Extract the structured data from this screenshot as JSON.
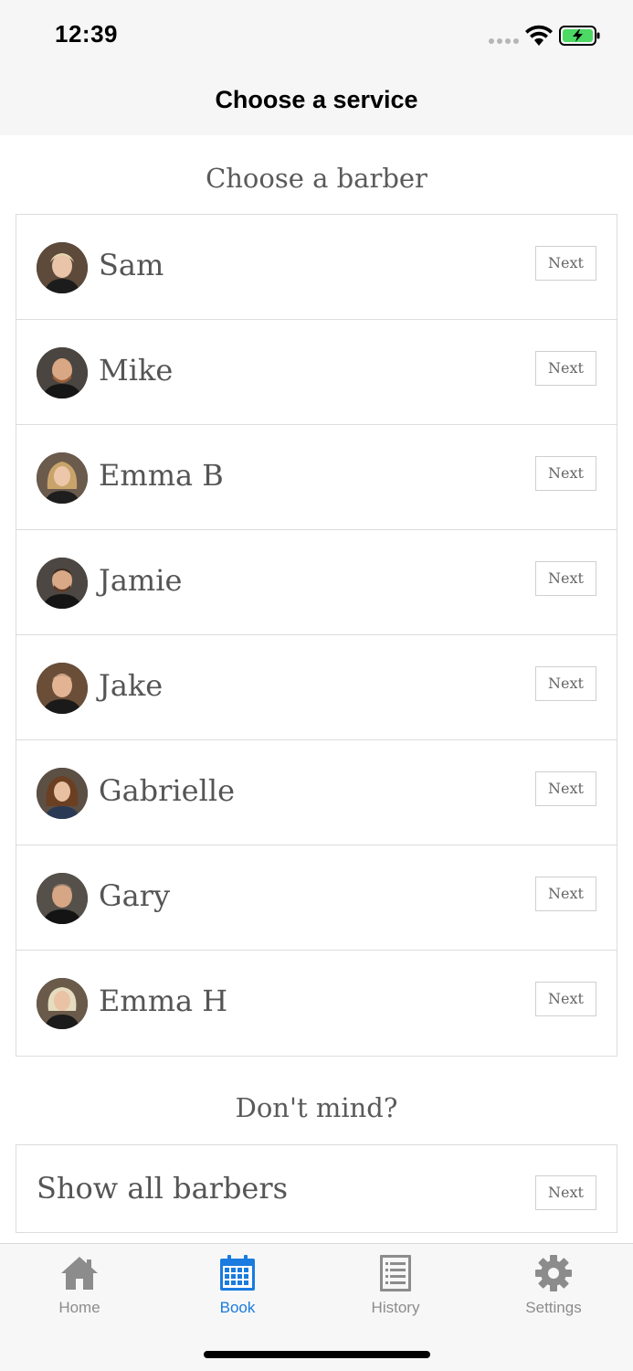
{
  "status_bar": {
    "time": "12:39"
  },
  "nav": {
    "title": "Choose a service"
  },
  "barber_section": {
    "heading": "Choose a barber",
    "barbers": [
      {
        "name": "Sam",
        "next_label": "Next"
      },
      {
        "name": "Mike",
        "next_label": "Next"
      },
      {
        "name": "Emma B",
        "next_label": "Next"
      },
      {
        "name": "Jamie",
        "next_label": "Next"
      },
      {
        "name": "Jake",
        "next_label": "Next"
      },
      {
        "name": "Gabrielle",
        "next_label": "Next"
      },
      {
        "name": "Gary",
        "next_label": "Next"
      },
      {
        "name": "Emma H",
        "next_label": "Next"
      }
    ]
  },
  "any_section": {
    "heading": "Don't mind?",
    "label": "Show all barbers",
    "next_label": "Next"
  },
  "tab_bar": {
    "tabs": [
      {
        "label": "Home",
        "icon": "home-icon",
        "active": false
      },
      {
        "label": "Book",
        "icon": "calendar-icon",
        "active": true
      },
      {
        "label": "History",
        "icon": "list-icon",
        "active": false
      },
      {
        "label": "Settings",
        "icon": "gear-icon",
        "active": false
      }
    ]
  },
  "colors": {
    "accent": "#1a7be0",
    "inactive": "#8c8c8c",
    "battery": "#4cd964"
  }
}
